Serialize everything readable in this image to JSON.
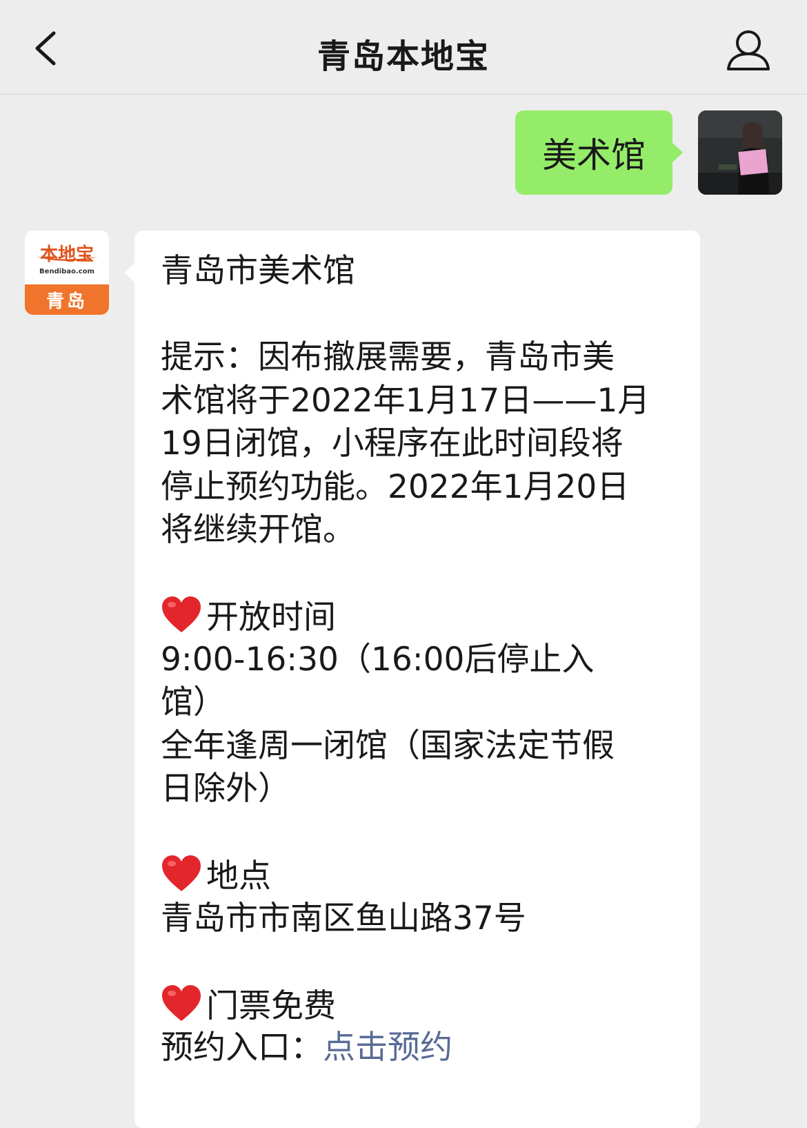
{
  "nav": {
    "title": "青岛本地宝",
    "back_icon": "chevron-left-icon",
    "profile_icon": "person-icon"
  },
  "outgoing": {
    "text": "美术馆"
  },
  "bot_avatar": {
    "brand": "本地宝",
    "domain": "Bendibao.com",
    "city": "青岛"
  },
  "message": {
    "title": "青岛市美术馆",
    "notice_lines": [
      "提示：因布撤展需要，青岛市美",
      "术馆将于2022年1月17日——1月",
      "19日闭馆，小程序在此时间段将",
      "停止预约功能。2022年1月20日",
      "将继续开馆。"
    ],
    "hours_heading": "开放时间",
    "hours_lines": [
      "9:00-16:30（16:00后停止入",
      "馆）",
      "全年逢周一闭馆（国家法定节假",
      "日除外）"
    ],
    "location_heading": "地点",
    "location_lines": [
      "青岛市市南区鱼山路37号"
    ],
    "ticket_heading": "门票免费",
    "booking_label": "预约入口：",
    "booking_link": "点击预约"
  },
  "colors": {
    "outgoing_bubble": "#95ec69",
    "link": "#576b95",
    "heart": "#e3262b",
    "brand": "#f0742b"
  }
}
